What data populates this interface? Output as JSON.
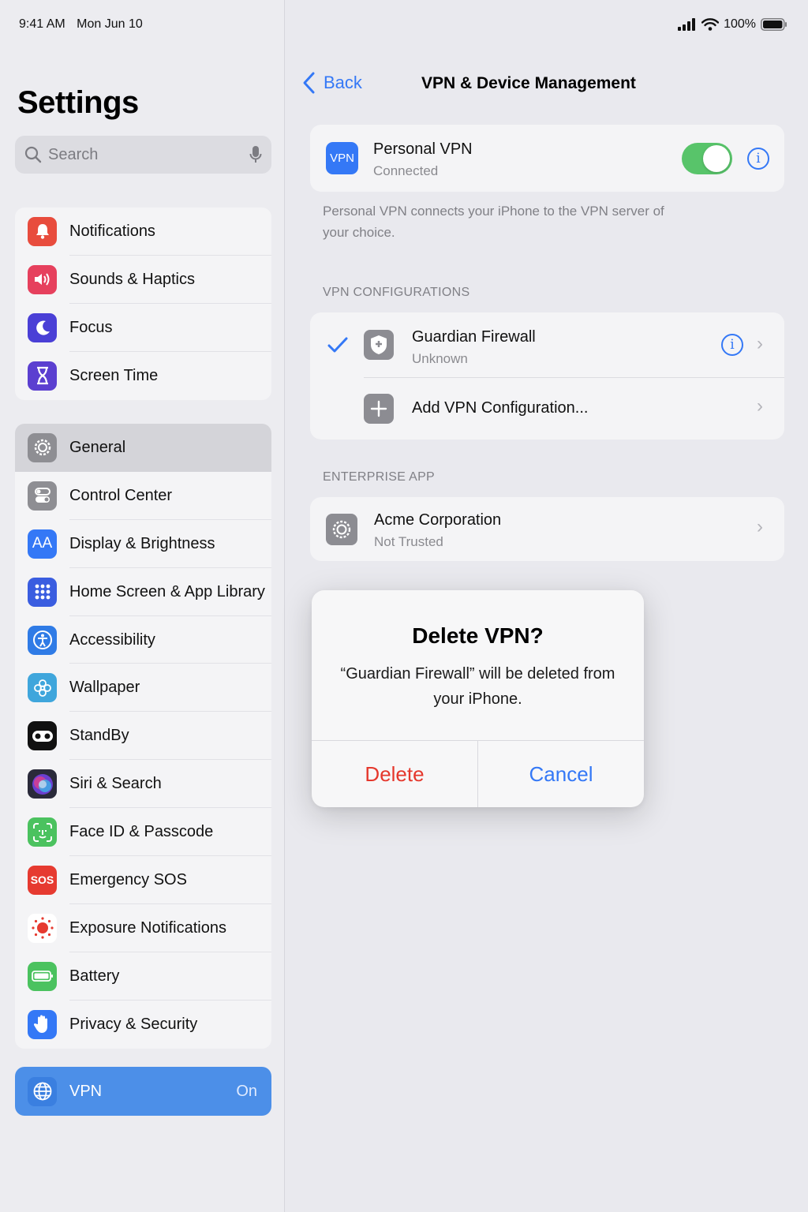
{
  "status": {
    "time": "9:41 AM",
    "date": "Mon Jun 10",
    "battery": "100%"
  },
  "sidebar": {
    "title": "Settings",
    "search_placeholder": "Search",
    "group1": [
      {
        "label": "Notifications",
        "icon": "bell-icon",
        "color": "#e84c3d"
      },
      {
        "label": "Sounds & Haptics",
        "icon": "speaker-icon",
        "color": "#e6405d"
      },
      {
        "label": "Focus",
        "icon": "moon-icon",
        "color": "#4a3fd6"
      },
      {
        "label": "Screen Time",
        "icon": "hourglass-icon",
        "color": "#5b3fd0"
      }
    ],
    "group2": [
      {
        "label": "General",
        "icon": "gear-icon",
        "color": "#8e8e93"
      },
      {
        "label": "Control Center",
        "icon": "switches-icon",
        "color": "#8e8e93"
      },
      {
        "label": "Display & Brightness",
        "icon": "text-size-icon",
        "color": "#3478f6"
      },
      {
        "label": "Home Screen & App Library",
        "icon": "app-grid-icon",
        "color": "#3a5de0"
      },
      {
        "label": "Accessibility",
        "icon": "accessibility-icon",
        "color": "#2f7be6"
      },
      {
        "label": "Wallpaper",
        "icon": "flower-icon",
        "color": "#3fa6dc"
      },
      {
        "label": "StandBy",
        "icon": "standby-icon",
        "color": "#111111"
      },
      {
        "label": "Siri & Search",
        "icon": "siri-icon",
        "color": "#2a2a3a"
      },
      {
        "label": "Face ID & Passcode",
        "icon": "face-id-icon",
        "color": "#4bc25f"
      },
      {
        "label": "Emergency SOS",
        "icon": "sos-icon",
        "color": "#e63a30"
      },
      {
        "label": "Exposure Notifications",
        "icon": "exposure-icon",
        "color": "#ffffff"
      },
      {
        "label": "Battery",
        "icon": "battery-icon",
        "color": "#4bc25f"
      },
      {
        "label": "Privacy & Security",
        "icon": "hand-icon",
        "color": "#3478f6"
      }
    ],
    "vpn": {
      "label": "VPN",
      "value": "On"
    }
  },
  "nav": {
    "back": "Back",
    "title": "VPN & Device Management"
  },
  "personal_vpn": {
    "badge": "VPN",
    "title": "Personal VPN",
    "subtitle": "Connected",
    "toggle_on": true,
    "footer": "Personal VPN connects your iPhone to the VPN server of your choice."
  },
  "vpn_configs": {
    "header": "VPN CONFIGURATIONS",
    "item": {
      "title": "Guardian Firewall",
      "subtitle": "Unknown"
    },
    "add_label": "Add VPN Configuration..."
  },
  "enterprise": {
    "header": "ENTERPRISE APP",
    "title": "Acme Corporation",
    "subtitle": "Not Trusted"
  },
  "dialog": {
    "title": "Delete VPN?",
    "message": "“Guardian Firewall” will be deleted from your iPhone.",
    "delete": "Delete",
    "cancel": "Cancel"
  },
  "colors": {
    "accent": "#3478f6",
    "destructive": "#e5382d",
    "toggle_on": "#58c46a"
  }
}
